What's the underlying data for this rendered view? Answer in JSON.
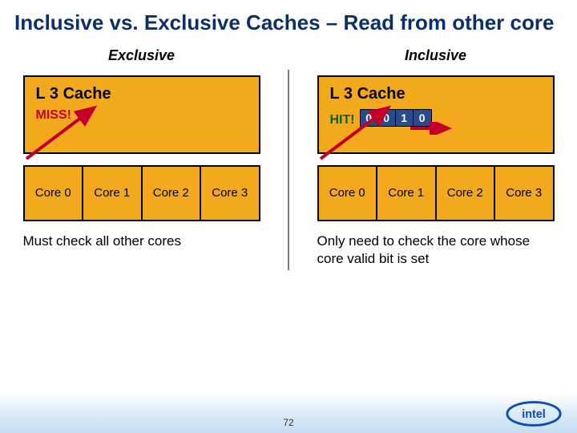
{
  "title": "Inclusive vs. Exclusive Caches – Read from other core",
  "left": {
    "label": "Exclusive",
    "l3": "L 3 Cache",
    "status": "MISS!",
    "cores": [
      "Core 0",
      "Core 1",
      "Core 2",
      "Core 3"
    ],
    "explain": "Must check all other cores"
  },
  "right": {
    "label": "Inclusive",
    "l3": "L 3 Cache",
    "status": "HIT!",
    "bits": [
      "0",
      "0",
      "1",
      "0"
    ],
    "cores": [
      "Core 0",
      "Core 1",
      "Core 2",
      "Core 3"
    ],
    "explain": "Only need to check the core whose core valid bit is set"
  },
  "page": "72"
}
